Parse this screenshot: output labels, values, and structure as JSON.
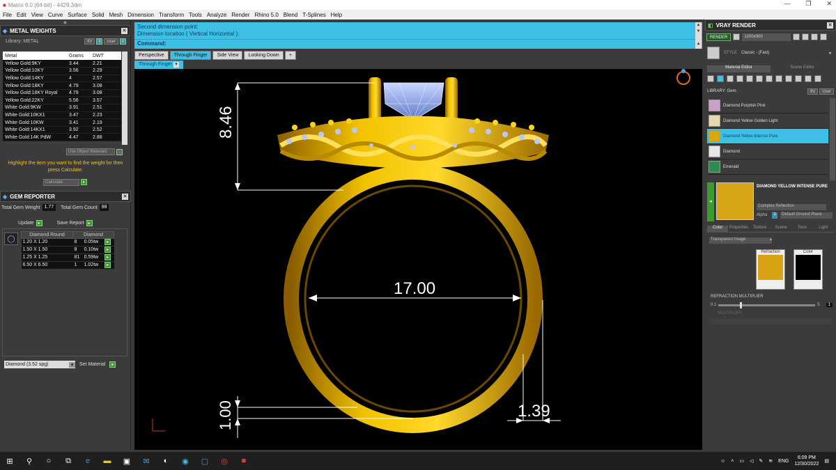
{
  "window": {
    "title": "Matrix 9.0 (64-bit) - 4429.3dm",
    "controls": [
      "—",
      "❐",
      "✕"
    ]
  },
  "menu": [
    "File",
    "Edit",
    "View",
    "Curve",
    "Surface",
    "Solid",
    "Mesh",
    "Dimension",
    "Transform",
    "Tools",
    "Analyze",
    "Render",
    "Rhino 5.0",
    "Blend",
    "T-Splines",
    "Help"
  ],
  "metal_weights": {
    "title": "METAL WEIGHTS",
    "library_label": "Library: METAL",
    "library_btns": [
      "9V",
      "User"
    ],
    "columns": [
      "Metal",
      "Grams",
      "DWT"
    ],
    "rows": [
      [
        "Yellow Gold:9KY",
        "3.44",
        "2.21"
      ],
      [
        "Yellow Gold:10KY",
        "3.56",
        "2.29"
      ],
      [
        "Yellow Gold:14KY",
        "4",
        "2.57"
      ],
      [
        "Yellow Gold:18KY",
        "4.79",
        "3.08"
      ],
      [
        "Yellow Gold:18KY Royal",
        "4.79",
        "3.08"
      ],
      [
        "Yellow Gold:22KY",
        "5.56",
        "3.57"
      ],
      [
        "White Gold:9KW",
        "3.91",
        "2.51"
      ],
      [
        "White Gold:10KX1",
        "3.47",
        "2.23"
      ],
      [
        "White Gold:10KW",
        "3.41",
        "2.19"
      ],
      [
        "White Gold:14KX1",
        "3.92",
        "2.52"
      ],
      [
        "White Gold:14K PdW",
        "4.47",
        "2.88"
      ]
    ],
    "use_object_materials": "Use Object Materials",
    "hint": "Highlight the item you want to find the weight for then press Calculate.",
    "calculate": "Calculate"
  },
  "gem_reporter": {
    "title": "GEM REPORTER",
    "total_weight_label": "Total Gem Weight",
    "total_weight": "1.77",
    "total_count_label": "Total Gem Count",
    "total_count": "98",
    "update": "Update",
    "save_report": "Save Report",
    "columns": [
      "Diamond Round",
      "Diamond"
    ],
    "rows": [
      [
        "1.20 X 1.20",
        "8",
        "0.05tw"
      ],
      [
        "1.50 X 1.50",
        "8",
        "0.10tw"
      ],
      [
        "1.25 X 1.25",
        "81",
        "0.59tw"
      ],
      [
        "6.50 X 6.50",
        "1",
        "1.02tw"
      ]
    ],
    "material_select": "Diamond     (3.52 spg)",
    "set_material": "Set Material"
  },
  "command": {
    "line1": "Second dimension point:",
    "line2": "Dimension location ( Vertical  Horizontal ):",
    "prompt": "Command:"
  },
  "view_tabs": [
    "Perspective",
    "Through Finger",
    "Side View",
    "Looking Down",
    "+"
  ],
  "active_view": "Through Finger",
  "dimensions": {
    "height": "8.46",
    "diameter": "17.00",
    "thickness": "1.00",
    "band_width": "1.39"
  },
  "vray": {
    "title": "VRAY RENDER",
    "render_btn": "RENDER",
    "resolution": "1200x900",
    "style_label": "STYLE",
    "style_value": "Classic - (Fast)",
    "tabs": [
      "Material Editor",
      "Scene Editor"
    ],
    "library_label": "LIBRARY: Gem",
    "library_btns": [
      "9V",
      "User"
    ],
    "materials": [
      "Diamond Purplish Pink",
      "Diamond Yellow Golden Light",
      "Diamond Yellow Intense Pure",
      "Diamond",
      "Emerald"
    ],
    "selected_material": "DIAMOND YELLOW INTENSE PURE",
    "reflection": "Complex Reflection",
    "alpha_label": "Alpha",
    "alpha_value": "1",
    "ground_plane": "Default Ground Plane",
    "prop_tabs": [
      "Color",
      "Properties",
      "Texture",
      "Scene",
      "Toon",
      "Light"
    ],
    "transparent": "Transparent Image",
    "refraction_label": "Refraction",
    "color_label": "Color",
    "refraction_multiplier": "REFRACTION MULTIPLIER",
    "slider_min": "0.1",
    "slider_max": "5",
    "slider_value": "1",
    "multiplier_2": "MULTIPLIER"
  },
  "taskbar": {
    "language": "ENG",
    "time": "6:09 PM",
    "date": "12/30/2022"
  }
}
